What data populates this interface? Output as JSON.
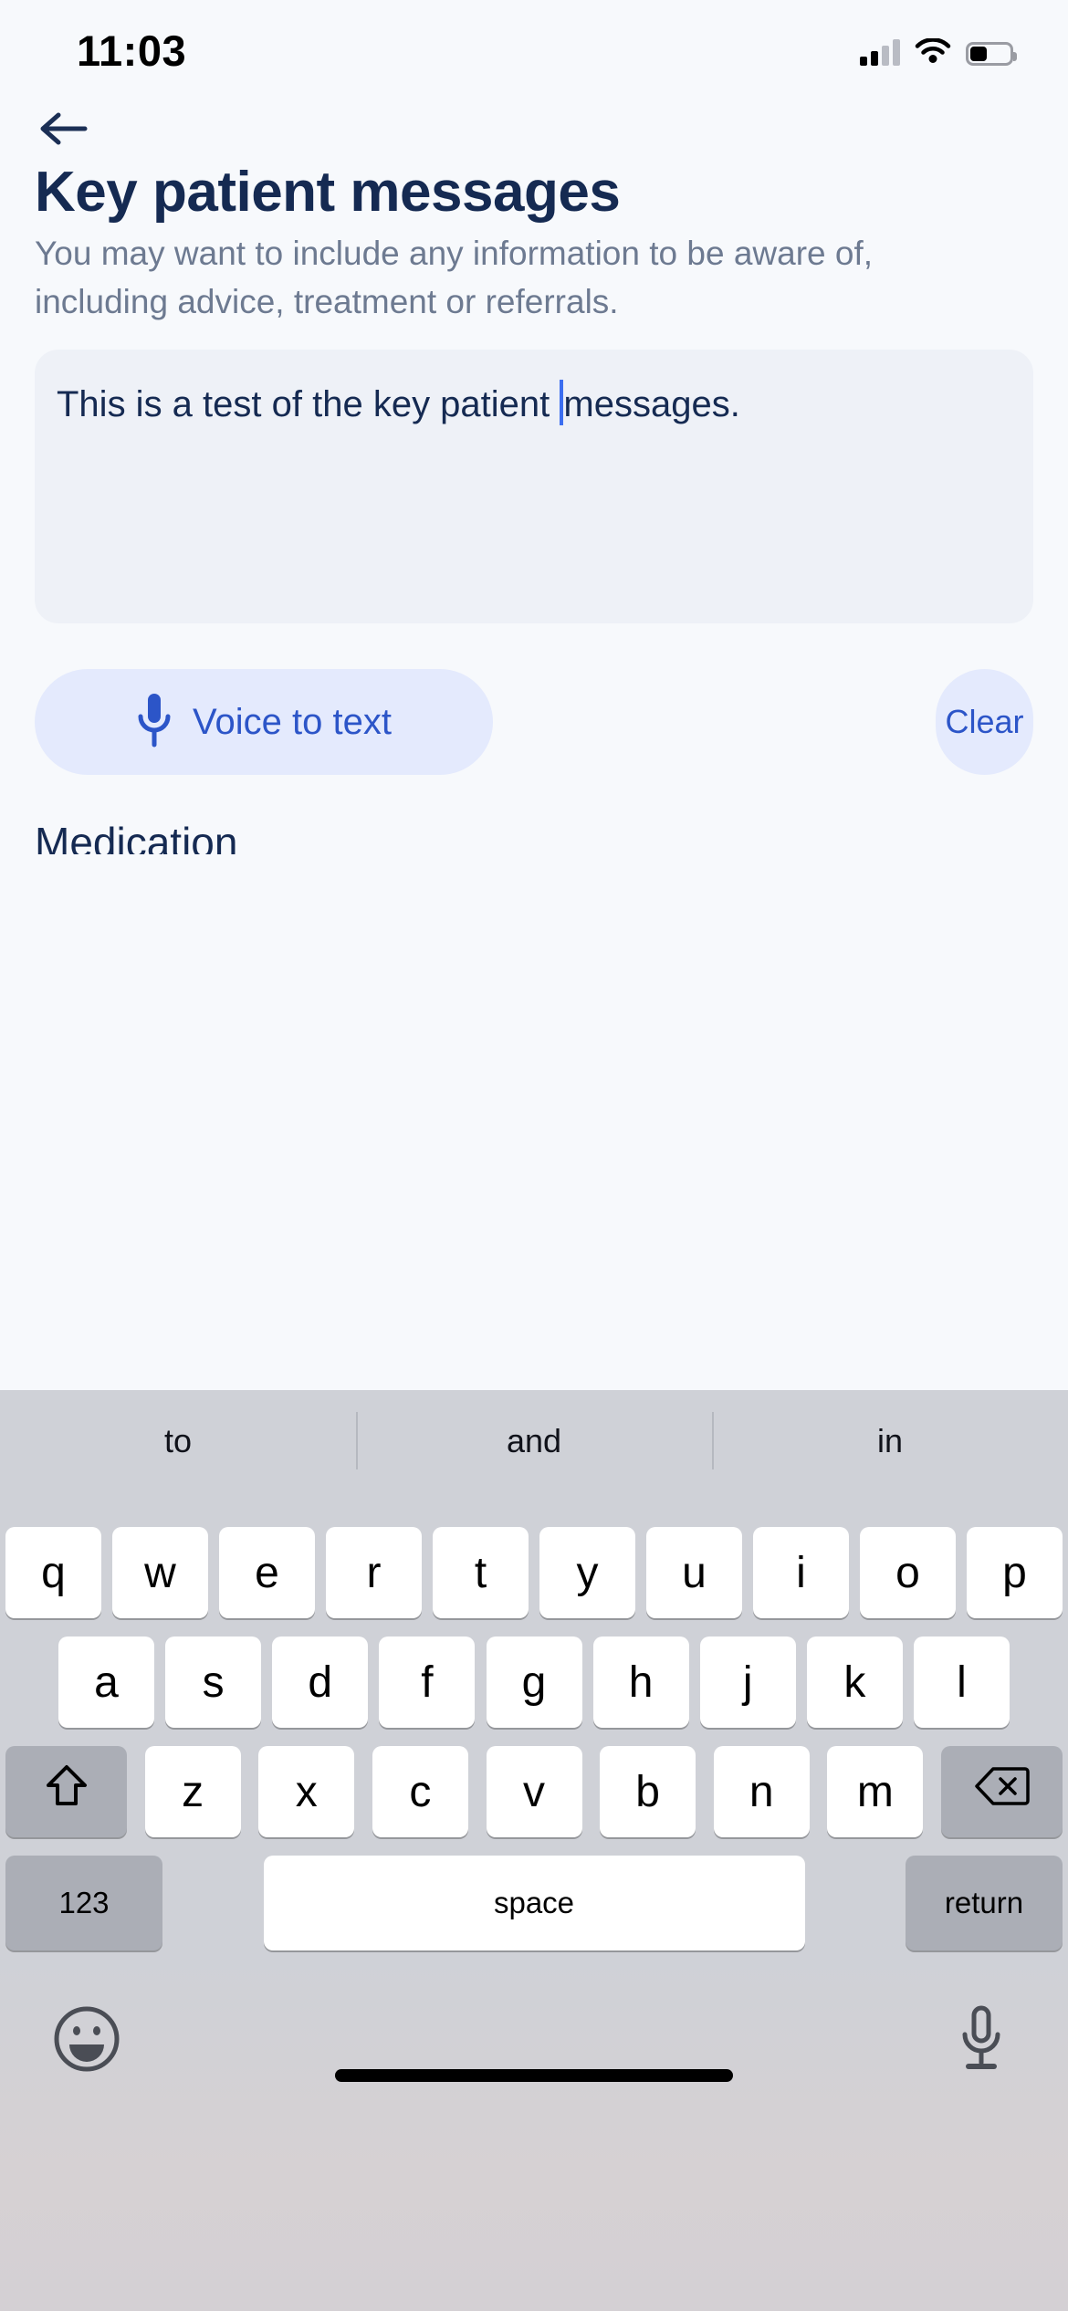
{
  "status_bar": {
    "time": "11:03",
    "cellular_icon": "cellular-signal-icon",
    "wifi_icon": "wifi-icon",
    "battery_icon": "battery-icon",
    "battery_level_percent": 42
  },
  "nav": {
    "back_icon": "arrow-left-icon"
  },
  "page": {
    "title": "Key patient messages",
    "description": "You may want to include any information to be aware of, including advice, treatment or referrals.",
    "next_section_label": "Medication"
  },
  "text_field": {
    "value_before_caret": "This is a test of the key patient ",
    "value_after_caret": "messages.",
    "full_value": "This is a test of the key patient messages.",
    "placeholder": "",
    "caret_color": "#3c6ef0",
    "background": "#eef1f7"
  },
  "actions": {
    "voice_label": "Voice to text",
    "voice_icon": "microphone-icon",
    "clear_label": "Clear",
    "accent_color": "#2c55c8",
    "pill_background": "#e4eafd"
  },
  "keyboard": {
    "predictions": [
      "to",
      "and",
      "in"
    ],
    "row1": [
      "q",
      "w",
      "e",
      "r",
      "t",
      "y",
      "u",
      "i",
      "o",
      "p"
    ],
    "row2": [
      "a",
      "s",
      "d",
      "f",
      "g",
      "h",
      "j",
      "k",
      "l"
    ],
    "row3_letters": [
      "z",
      "x",
      "c",
      "v",
      "b",
      "n",
      "m"
    ],
    "shift_icon": "shift-arrow-up-icon",
    "backspace_icon": "backspace-delete-icon",
    "numbers_label": "123",
    "space_label": "space",
    "return_label": "return",
    "emoji_icon": "emoji-smiley-icon",
    "dictation_icon": "microphone-dictation-icon"
  }
}
